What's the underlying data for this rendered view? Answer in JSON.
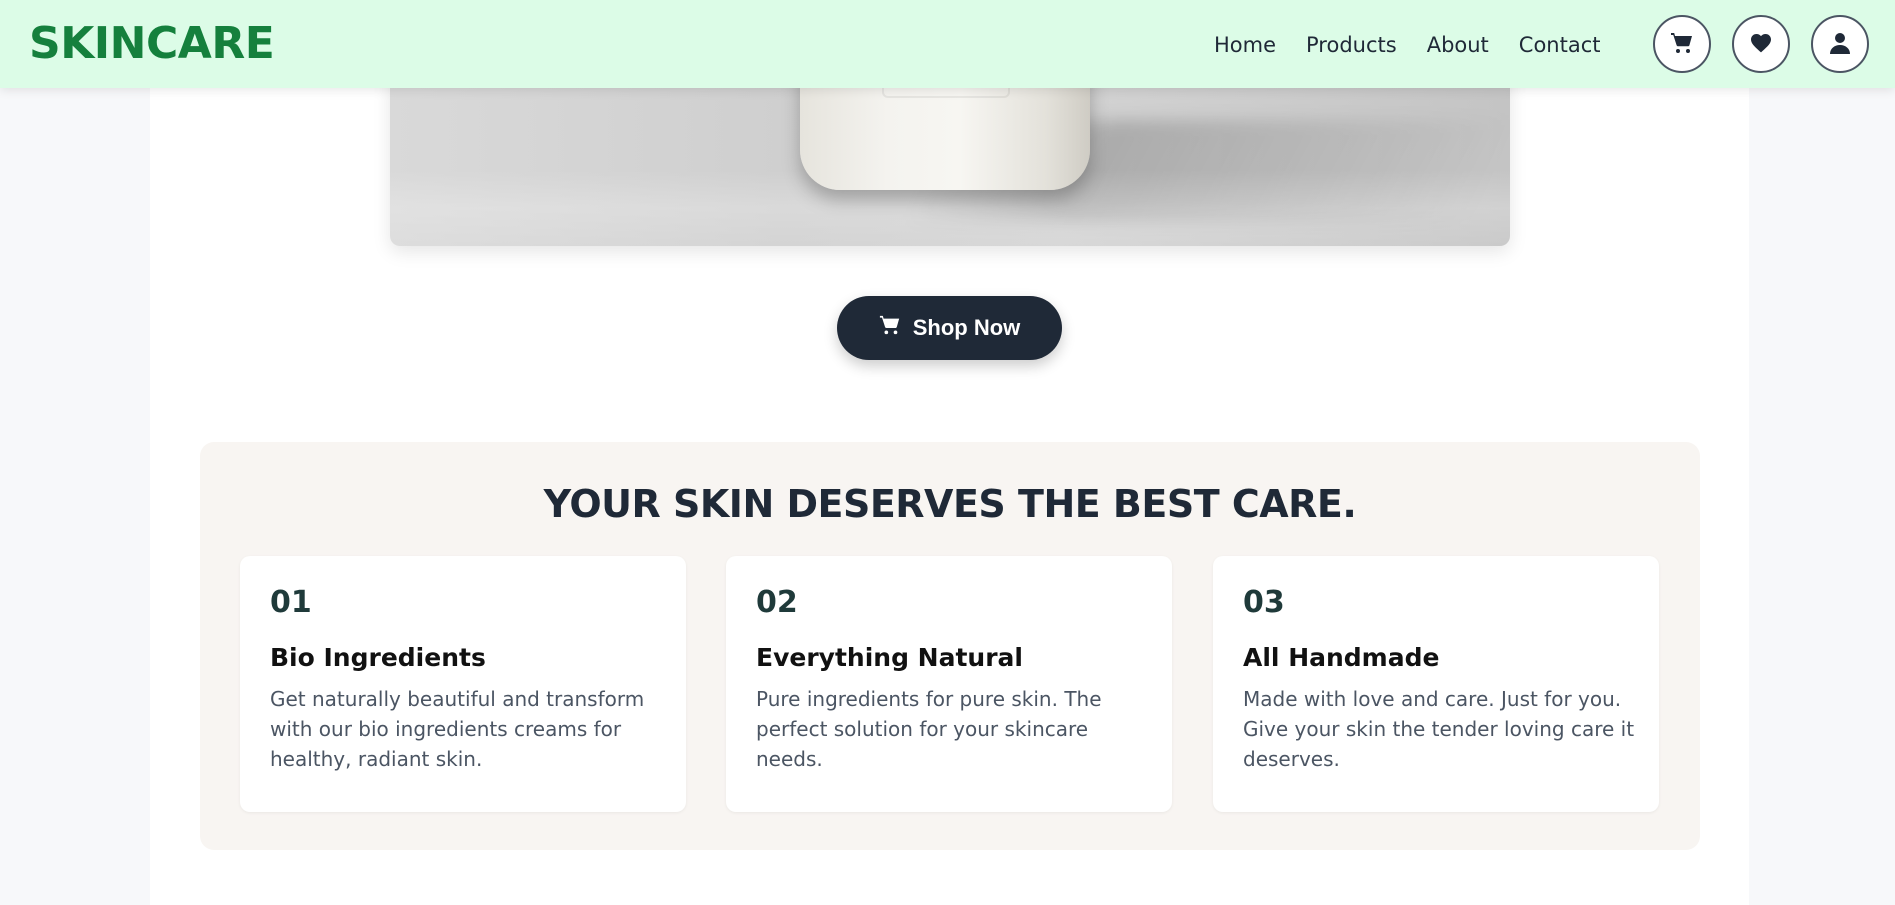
{
  "header": {
    "logo": "SKINCARE",
    "nav": [
      "Home",
      "Products",
      "About",
      "Contact"
    ],
    "icons": [
      "cart-icon",
      "heart-icon",
      "user-icon"
    ]
  },
  "hero": {
    "shop_button_label": "Shop Now"
  },
  "features": {
    "title": "YOUR SKIN DESERVES THE BEST CARE.",
    "cards": [
      {
        "number": "01",
        "title": "Bio Ingredients",
        "description": "Get naturally beautiful and transform with our bio ingredients creams for healthy, radiant skin."
      },
      {
        "number": "02",
        "title": "Everything Natural",
        "description": "Pure ingredients for pure skin. The perfect solution for your skincare needs."
      },
      {
        "number": "03",
        "title": "All Handmade",
        "description": "Made with love and care. Just for you. Give your skin the tender loving care it deserves."
      }
    ]
  },
  "colors": {
    "header_bg": "#dcfce7",
    "brand_green": "#15803d",
    "button_dark": "#1f2937",
    "features_bg": "#f8f5f2"
  }
}
